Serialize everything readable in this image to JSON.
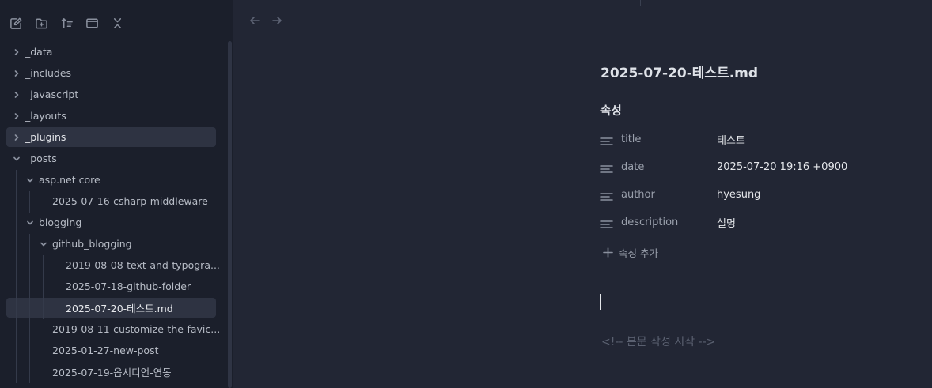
{
  "toolbar": {
    "buttons": [
      {
        "icon": "new-note-icon"
      },
      {
        "icon": "new-folder-icon"
      },
      {
        "icon": "sort-icon"
      },
      {
        "icon": "auto-reveal-icon"
      },
      {
        "icon": "collapse-all-icon"
      }
    ]
  },
  "tree": {
    "items": [
      {
        "label": "_data",
        "depth": 0,
        "expanded": false,
        "folder": true
      },
      {
        "label": "_includes",
        "depth": 0,
        "expanded": false,
        "folder": true
      },
      {
        "label": "_javascript",
        "depth": 0,
        "expanded": false,
        "folder": true
      },
      {
        "label": "_layouts",
        "depth": 0,
        "expanded": false,
        "folder": true
      },
      {
        "label": "_plugins",
        "depth": 0,
        "expanded": false,
        "folder": true,
        "highlighted": true
      },
      {
        "label": "_posts",
        "depth": 0,
        "expanded": true,
        "folder": true
      },
      {
        "label": "asp.net core",
        "depth": 1,
        "expanded": true,
        "folder": true
      },
      {
        "label": "2025-07-16-csharp-middleware",
        "depth": 2,
        "folder": false
      },
      {
        "label": "blogging",
        "depth": 1,
        "expanded": true,
        "folder": true
      },
      {
        "label": "github_blogging",
        "depth": 2,
        "expanded": true,
        "folder": true
      },
      {
        "label": "2019-08-08-text-and-typogra...",
        "depth": 3,
        "folder": false
      },
      {
        "label": "2025-07-18-github-folder",
        "depth": 3,
        "folder": false
      },
      {
        "label": "2025-07-20-테스트.md",
        "depth": 3,
        "folder": false,
        "active": true
      },
      {
        "label": "2019-08-11-customize-the-favic...",
        "depth": 2,
        "folder": false
      },
      {
        "label": "2025-01-27-new-post",
        "depth": 2,
        "folder": false
      },
      {
        "label": "2025-07-19-옵시디언-연동",
        "depth": 2,
        "folder": false
      }
    ]
  },
  "editor": {
    "title": "2025-07-20-테스트.md",
    "properties_heading": "속성",
    "properties": [
      {
        "key": "title",
        "value": "테스트"
      },
      {
        "key": "date",
        "value": "2025-07-20 19:16 +0900"
      },
      {
        "key": "author",
        "value": "hyesung"
      },
      {
        "key": "description",
        "value": "설명"
      }
    ],
    "add_property_label": "속성 추가",
    "body_comment": "<!-- 본문 작성 시작 -->"
  },
  "colors": {
    "sidebar_bg": "#1b1f2b",
    "editor_bg": "#222634",
    "highlight_bg": "#2e3342"
  }
}
